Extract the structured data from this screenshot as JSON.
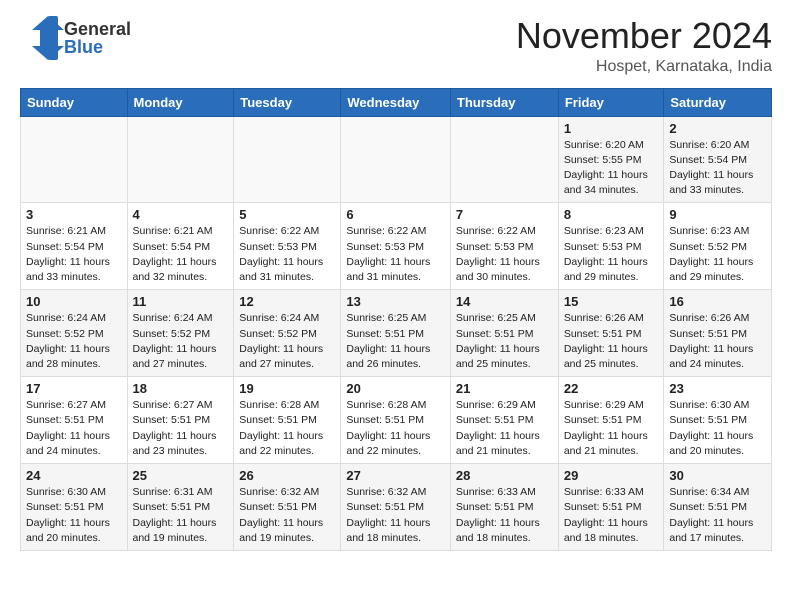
{
  "header": {
    "logo_general": "General",
    "logo_blue": "Blue",
    "month_title": "November 2024",
    "location": "Hospet, Karnataka, India"
  },
  "days_of_week": [
    "Sunday",
    "Monday",
    "Tuesday",
    "Wednesday",
    "Thursday",
    "Friday",
    "Saturday"
  ],
  "weeks": [
    [
      {
        "day": "",
        "info": ""
      },
      {
        "day": "",
        "info": ""
      },
      {
        "day": "",
        "info": ""
      },
      {
        "day": "",
        "info": ""
      },
      {
        "day": "",
        "info": ""
      },
      {
        "day": "1",
        "info": "Sunrise: 6:20 AM\nSunset: 5:55 PM\nDaylight: 11 hours and 34 minutes."
      },
      {
        "day": "2",
        "info": "Sunrise: 6:20 AM\nSunset: 5:54 PM\nDaylight: 11 hours and 33 minutes."
      }
    ],
    [
      {
        "day": "3",
        "info": "Sunrise: 6:21 AM\nSunset: 5:54 PM\nDaylight: 11 hours and 33 minutes."
      },
      {
        "day": "4",
        "info": "Sunrise: 6:21 AM\nSunset: 5:54 PM\nDaylight: 11 hours and 32 minutes."
      },
      {
        "day": "5",
        "info": "Sunrise: 6:22 AM\nSunset: 5:53 PM\nDaylight: 11 hours and 31 minutes."
      },
      {
        "day": "6",
        "info": "Sunrise: 6:22 AM\nSunset: 5:53 PM\nDaylight: 11 hours and 31 minutes."
      },
      {
        "day": "7",
        "info": "Sunrise: 6:22 AM\nSunset: 5:53 PM\nDaylight: 11 hours and 30 minutes."
      },
      {
        "day": "8",
        "info": "Sunrise: 6:23 AM\nSunset: 5:53 PM\nDaylight: 11 hours and 29 minutes."
      },
      {
        "day": "9",
        "info": "Sunrise: 6:23 AM\nSunset: 5:52 PM\nDaylight: 11 hours and 29 minutes."
      }
    ],
    [
      {
        "day": "10",
        "info": "Sunrise: 6:24 AM\nSunset: 5:52 PM\nDaylight: 11 hours and 28 minutes."
      },
      {
        "day": "11",
        "info": "Sunrise: 6:24 AM\nSunset: 5:52 PM\nDaylight: 11 hours and 27 minutes."
      },
      {
        "day": "12",
        "info": "Sunrise: 6:24 AM\nSunset: 5:52 PM\nDaylight: 11 hours and 27 minutes."
      },
      {
        "day": "13",
        "info": "Sunrise: 6:25 AM\nSunset: 5:51 PM\nDaylight: 11 hours and 26 minutes."
      },
      {
        "day": "14",
        "info": "Sunrise: 6:25 AM\nSunset: 5:51 PM\nDaylight: 11 hours and 25 minutes."
      },
      {
        "day": "15",
        "info": "Sunrise: 6:26 AM\nSunset: 5:51 PM\nDaylight: 11 hours and 25 minutes."
      },
      {
        "day": "16",
        "info": "Sunrise: 6:26 AM\nSunset: 5:51 PM\nDaylight: 11 hours and 24 minutes."
      }
    ],
    [
      {
        "day": "17",
        "info": "Sunrise: 6:27 AM\nSunset: 5:51 PM\nDaylight: 11 hours and 24 minutes."
      },
      {
        "day": "18",
        "info": "Sunrise: 6:27 AM\nSunset: 5:51 PM\nDaylight: 11 hours and 23 minutes."
      },
      {
        "day": "19",
        "info": "Sunrise: 6:28 AM\nSunset: 5:51 PM\nDaylight: 11 hours and 22 minutes."
      },
      {
        "day": "20",
        "info": "Sunrise: 6:28 AM\nSunset: 5:51 PM\nDaylight: 11 hours and 22 minutes."
      },
      {
        "day": "21",
        "info": "Sunrise: 6:29 AM\nSunset: 5:51 PM\nDaylight: 11 hours and 21 minutes."
      },
      {
        "day": "22",
        "info": "Sunrise: 6:29 AM\nSunset: 5:51 PM\nDaylight: 11 hours and 21 minutes."
      },
      {
        "day": "23",
        "info": "Sunrise: 6:30 AM\nSunset: 5:51 PM\nDaylight: 11 hours and 20 minutes."
      }
    ],
    [
      {
        "day": "24",
        "info": "Sunrise: 6:30 AM\nSunset: 5:51 PM\nDaylight: 11 hours and 20 minutes."
      },
      {
        "day": "25",
        "info": "Sunrise: 6:31 AM\nSunset: 5:51 PM\nDaylight: 11 hours and 19 minutes."
      },
      {
        "day": "26",
        "info": "Sunrise: 6:32 AM\nSunset: 5:51 PM\nDaylight: 11 hours and 19 minutes."
      },
      {
        "day": "27",
        "info": "Sunrise: 6:32 AM\nSunset: 5:51 PM\nDaylight: 11 hours and 18 minutes."
      },
      {
        "day": "28",
        "info": "Sunrise: 6:33 AM\nSunset: 5:51 PM\nDaylight: 11 hours and 18 minutes."
      },
      {
        "day": "29",
        "info": "Sunrise: 6:33 AM\nSunset: 5:51 PM\nDaylight: 11 hours and 18 minutes."
      },
      {
        "day": "30",
        "info": "Sunrise: 6:34 AM\nSunset: 5:51 PM\nDaylight: 11 hours and 17 minutes."
      }
    ]
  ]
}
